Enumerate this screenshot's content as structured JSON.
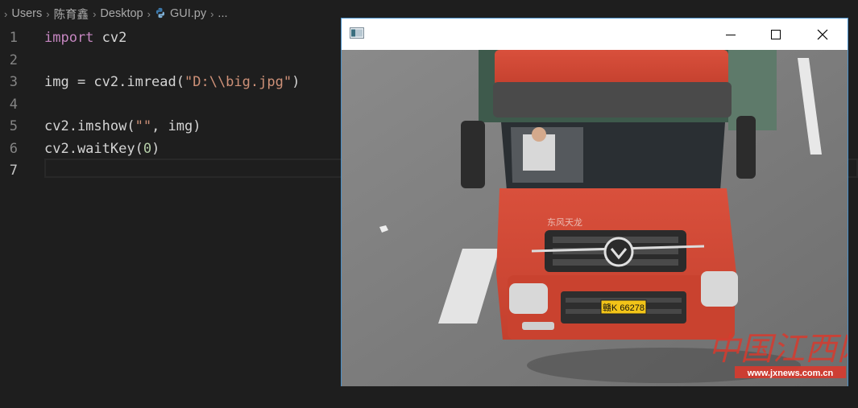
{
  "breadcrumb": {
    "items": [
      "Users",
      "陈育鑫",
      "Desktop",
      "GUI.py",
      "..."
    ]
  },
  "editor": {
    "lines": [
      {
        "number": "1",
        "tokens": [
          {
            "t": "import",
            "c": "kw"
          },
          {
            "t": " cv2",
            "c": ""
          }
        ]
      },
      {
        "number": "2",
        "tokens": []
      },
      {
        "number": "3",
        "tokens": [
          {
            "t": "img = cv2.imread(",
            "c": ""
          },
          {
            "t": "\"D:\\\\big.jpg\"",
            "c": "str"
          },
          {
            "t": ")",
            "c": ""
          }
        ]
      },
      {
        "number": "4",
        "tokens": []
      },
      {
        "number": "5",
        "tokens": [
          {
            "t": "cv2.imshow(",
            "c": ""
          },
          {
            "t": "\"\"",
            "c": "str"
          },
          {
            "t": ", img)",
            "c": ""
          }
        ]
      },
      {
        "number": "6",
        "tokens": [
          {
            "t": "cv2.waitKey(",
            "c": ""
          },
          {
            "t": "0",
            "c": "num"
          },
          {
            "t": ")",
            "c": ""
          }
        ]
      },
      {
        "number": "7",
        "tokens": []
      }
    ],
    "active_line": "7"
  },
  "image_window": {
    "title": "",
    "watermark": "中国江西网",
    "watermark_url": "www.jxnews.com.cn",
    "truck_brand": "东风天龙",
    "plate": "赣K 66278"
  },
  "colors": {
    "background": "#1e1e1e",
    "keyword": "#c586c0",
    "string": "#ce9178",
    "number": "#b5cea8",
    "window_border": "#4a90c8"
  }
}
